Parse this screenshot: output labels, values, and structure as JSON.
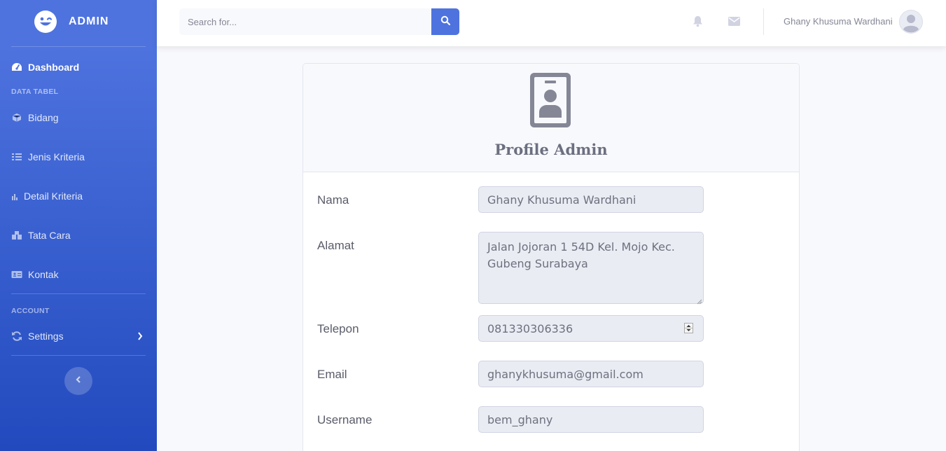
{
  "brand": {
    "name": "ADMIN"
  },
  "sidebar": {
    "dashboard": "Dashboard",
    "heading_data": "DATA TABEL",
    "items": [
      {
        "label": "Bidang",
        "icon": "cube-icon"
      },
      {
        "label": "Jenis Kriteria",
        "icon": "list-icon"
      },
      {
        "label": "Detail Kriteria",
        "icon": "chart-icon"
      },
      {
        "label": "Tata Cara",
        "icon": "boxes-icon"
      },
      {
        "label": "Kontak",
        "icon": "id-card-icon"
      }
    ],
    "heading_account": "ACCOUNT",
    "settings": "Settings"
  },
  "topbar": {
    "search_placeholder": "Search for...",
    "user_name": "Ghany Khusuma Wardhani"
  },
  "profile": {
    "title": "Profile Admin",
    "fields": {
      "nama": {
        "label": "Nama",
        "value": "Ghany Khusuma Wardhani"
      },
      "alamat": {
        "label": "Alamat",
        "value": "Jalan Jojoran 1 54D Kel. Mojo Kec. Gubeng Surabaya"
      },
      "telepon": {
        "label": "Telepon",
        "value": "081330306336"
      },
      "email": {
        "label": "Email",
        "value": "ghanykhusuma@gmail.com"
      },
      "username": {
        "label": "Username",
        "value": "bem_ghany"
      }
    }
  },
  "colors": {
    "primary": "#4e73df",
    "primary_dark": "#224abe",
    "text_gray": "#858796"
  }
}
